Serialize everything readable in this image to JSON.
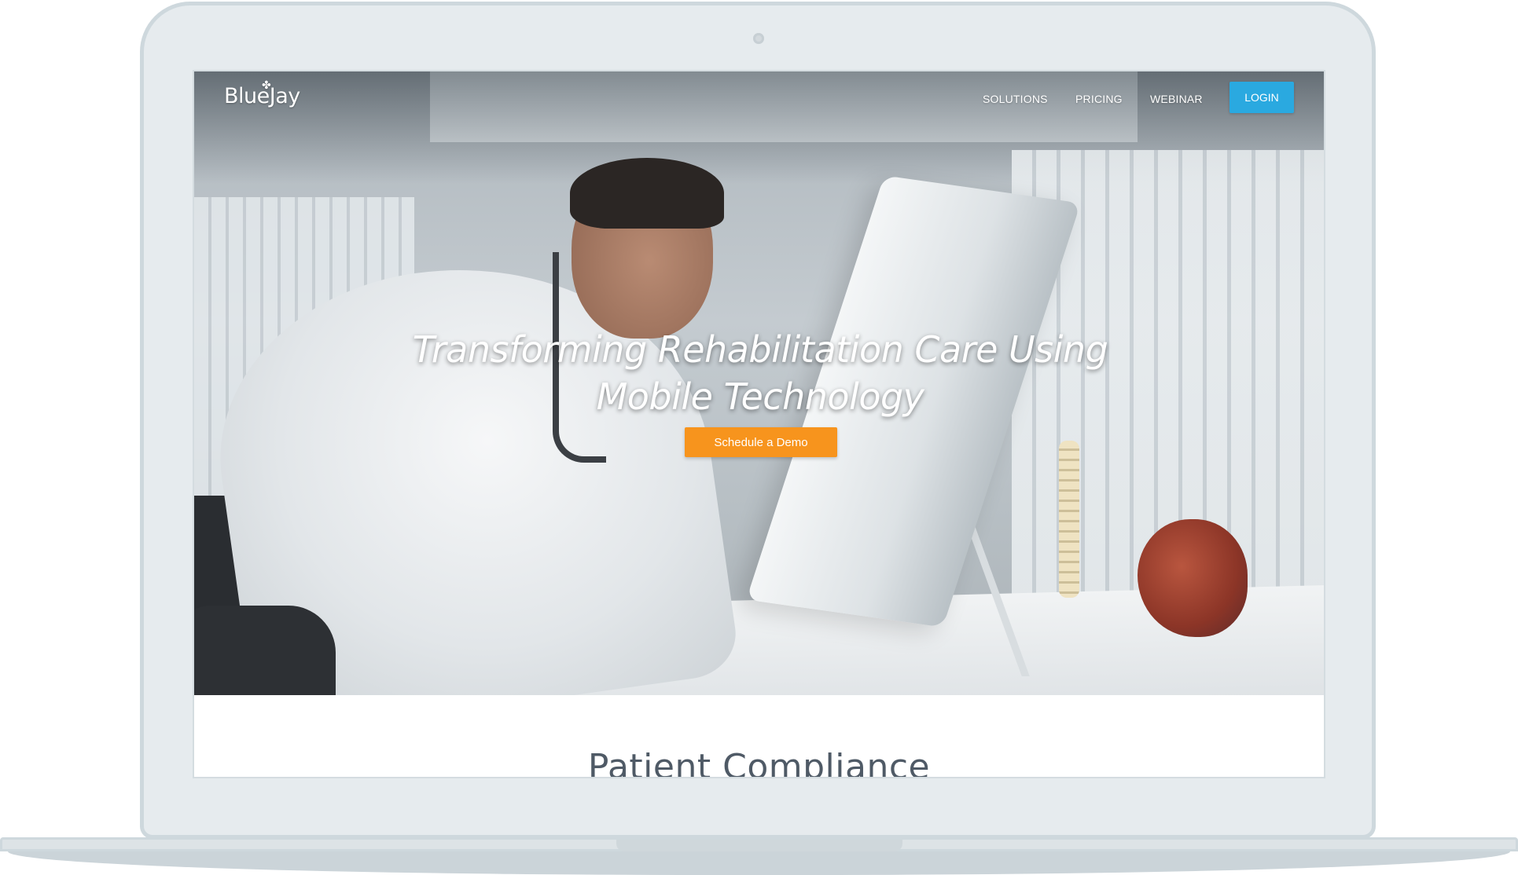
{
  "brand": {
    "logo_text": "BlueJay"
  },
  "nav": {
    "links": [
      "SOLUTIONS",
      "PRICING",
      "WEBINAR"
    ],
    "login_label": "LOGIN"
  },
  "hero": {
    "title": "Transforming Rehabilitation Care Using Mobile Technology",
    "cta_label": "Schedule a Demo"
  },
  "next_section": {
    "title": "Patient Compliance"
  },
  "colors": {
    "login_button": "#2aa9e0",
    "cta_button": "#f7941d",
    "section_title": "#4f5a66"
  },
  "icons": {
    "logo_bird": "bird-icon",
    "camera": "camera-icon"
  }
}
